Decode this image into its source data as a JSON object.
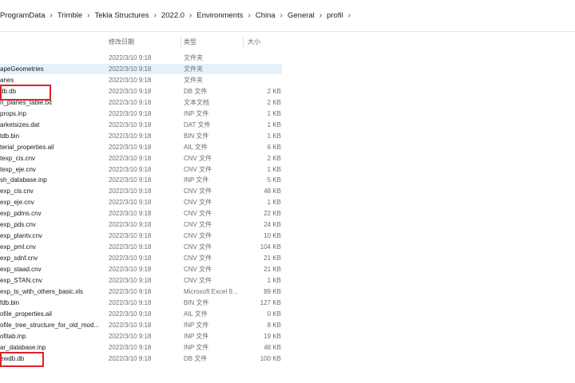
{
  "breadcrumb": [
    "ProgramData",
    "Trimble",
    "Tekla Structures",
    "2022.0",
    "Environments",
    "China",
    "General",
    "profil"
  ],
  "columns": {
    "date": "修改日期",
    "type": "类型",
    "size": "大小"
  },
  "files": [
    {
      "name": "",
      "date": "2022/3/10 9:18",
      "type": "文件夹",
      "size": ""
    },
    {
      "name": "apeGeometries",
      "date": "2022/3/10 9:18",
      "type": "文件夹",
      "size": "",
      "selected": true
    },
    {
      "name": "anes",
      "date": "2022/3/10 9:18",
      "type": "文件夹",
      "size": ""
    },
    {
      "name": "db.db",
      "date": "2022/3/10 9:18",
      "type": "DB 文件",
      "size": "2 KB"
    },
    {
      "name": "n_planes_table.txt",
      "date": "2022/3/10 9:18",
      "type": "文本文档",
      "size": "2 KB"
    },
    {
      "name": "props.inp",
      "date": "2022/3/10 9:18",
      "type": "INP 文件",
      "size": "1 KB"
    },
    {
      "name": "arketsizes.dat",
      "date": "2022/3/10 9:18",
      "type": "DAT 文件",
      "size": "1 KB"
    },
    {
      "name": "tdb.bin",
      "date": "2022/3/10 9:18",
      "type": "BIN 文件",
      "size": "1 KB"
    },
    {
      "name": "terial_properties.ail",
      "date": "2022/3/10 9:18",
      "type": "AIL 文件",
      "size": "6 KB"
    },
    {
      "name": "texp_cis.cnv",
      "date": "2022/3/10 9:18",
      "type": "CNV 文件",
      "size": "2 KB"
    },
    {
      "name": "texp_eje.cnv",
      "date": "2022/3/10 9:18",
      "type": "CNV 文件",
      "size": "1 KB"
    },
    {
      "name": "sh_database.inp",
      "date": "2022/3/10 9:18",
      "type": "INP 文件",
      "size": "5 KB"
    },
    {
      "name": "exp_cis.cnv",
      "date": "2022/3/10 9:18",
      "type": "CNV 文件",
      "size": "48 KB"
    },
    {
      "name": "exp_eje.cnv",
      "date": "2022/3/10 9:18",
      "type": "CNV 文件",
      "size": "1 KB"
    },
    {
      "name": "exp_pdms.cnv",
      "date": "2022/3/10 9:18",
      "type": "CNV 文件",
      "size": "22 KB"
    },
    {
      "name": "exp_pds.cnv",
      "date": "2022/3/10 9:18",
      "type": "CNV 文件",
      "size": "24 KB"
    },
    {
      "name": "exp_plantv.cnv",
      "date": "2022/3/10 9:18",
      "type": "CNV 文件",
      "size": "10 KB"
    },
    {
      "name": "exp_pml.cnv",
      "date": "2022/3/10 9:18",
      "type": "CNV 文件",
      "size": "104 KB"
    },
    {
      "name": "exp_sdnf.cnv",
      "date": "2022/3/10 9:18",
      "type": "CNV 文件",
      "size": "21 KB"
    },
    {
      "name": "exp_staad.cnv",
      "date": "2022/3/10 9:18",
      "type": "CNV 文件",
      "size": "21 KB"
    },
    {
      "name": "exp_STAN.cnv",
      "date": "2022/3/10 9:18",
      "type": "CNV 文件",
      "size": "1 KB"
    },
    {
      "name": "exp_ts_with_others_basic.xls",
      "date": "2022/3/10 9:18",
      "type": "Microsoft Excel 9...",
      "size": "89 KB"
    },
    {
      "name": "fdb.bin",
      "date": "2022/3/10 9:18",
      "type": "BIN 文件",
      "size": "127 KB"
    },
    {
      "name": "ofile_properties.ail",
      "date": "2022/3/10 9:18",
      "type": "AIL 文件",
      "size": "0 KB"
    },
    {
      "name": "ofile_tree_structure_for_old_mod...",
      "date": "2022/3/10 9:18",
      "type": "INP 文件",
      "size": "8 KB"
    },
    {
      "name": "ofitab.inp",
      "date": "2022/3/10 9:18",
      "type": "INP 文件",
      "size": "19 KB"
    },
    {
      "name": "ar_database.inp",
      "date": "2022/3/10 9:18",
      "type": "INP 文件",
      "size": "48 KB"
    },
    {
      "name": "ewdb.db",
      "date": "2022/3/10 9:18",
      "type": "DB 文件",
      "size": "100 KB"
    }
  ],
  "colors": {
    "selection": "#e5f1fb",
    "highlight": "#e0202a"
  }
}
